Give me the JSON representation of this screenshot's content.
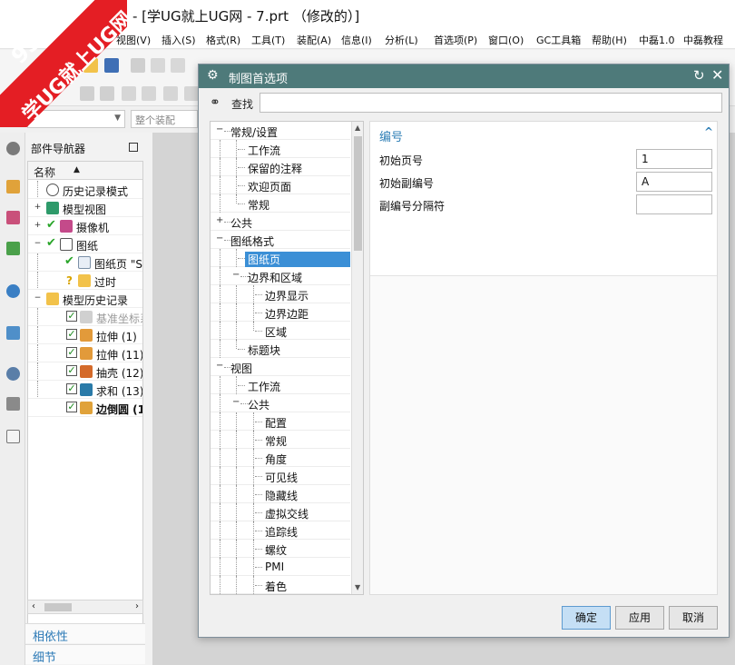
{
  "window": {
    "title": "- [学UG就上UG网 - 7.prt （修改的）]"
  },
  "watermark": {
    "line1": "9SUG",
    "line2": "学UG就上UG网"
  },
  "menu": [
    "视图(V)",
    "插入(S)",
    "格式(R)",
    "工具(T)",
    "装配(A)",
    "信息(I)",
    "分析(L)",
    "首选项(P)",
    "窗口(O)",
    "GC工具箱",
    "帮助(H)",
    "中磊1.0",
    "中磊教程"
  ],
  "toolbar": {
    "assembly_combo": "整个装配"
  },
  "navigator": {
    "title": "部件导航器",
    "column_header": "名称",
    "items": [
      {
        "label": "历史记录模式"
      },
      {
        "label": "模型视图"
      },
      {
        "label": "摄像机"
      },
      {
        "label": "图纸"
      },
      {
        "label": "图纸页 \"S"
      },
      {
        "label": "过时"
      },
      {
        "label": "模型历史记录"
      },
      {
        "label": "基准坐标系"
      },
      {
        "label": "拉伸 (1)"
      },
      {
        "label": "拉伸 (11)"
      },
      {
        "label": "抽壳 (12)"
      },
      {
        "label": "求和 (13)"
      },
      {
        "label": "边倒圆 (1"
      }
    ],
    "panels": [
      "相依性",
      "细节"
    ]
  },
  "dialog": {
    "title": "制图首选项",
    "find_label": "查找",
    "find_value": "",
    "tree": [
      {
        "label": "常规/设置"
      },
      {
        "label": "工作流"
      },
      {
        "label": "保留的注释"
      },
      {
        "label": "欢迎页面"
      },
      {
        "label": "常规"
      },
      {
        "label": "公共"
      },
      {
        "label": "图纸格式"
      },
      {
        "label": "图纸页"
      },
      {
        "label": "边界和区域"
      },
      {
        "label": "边界显示"
      },
      {
        "label": "边界边距"
      },
      {
        "label": "区域"
      },
      {
        "label": "标题块"
      },
      {
        "label": "视图"
      },
      {
        "label": "工作流"
      },
      {
        "label": "公共"
      },
      {
        "label": "配置"
      },
      {
        "label": "常规"
      },
      {
        "label": "角度"
      },
      {
        "label": "可见线"
      },
      {
        "label": "隐藏线"
      },
      {
        "label": "虚拟交线"
      },
      {
        "label": "追踪线"
      },
      {
        "label": "螺纹"
      },
      {
        "label": "PMI"
      },
      {
        "label": "着色"
      }
    ],
    "section": {
      "title": "编号",
      "fields": [
        {
          "label": "初始页号",
          "value": "1"
        },
        {
          "label": "初始副编号",
          "value": "A"
        },
        {
          "label": "副编号分隔符",
          "value": ""
        }
      ]
    },
    "buttons": {
      "ok": "确定",
      "apply": "应用",
      "cancel": "取消"
    }
  }
}
